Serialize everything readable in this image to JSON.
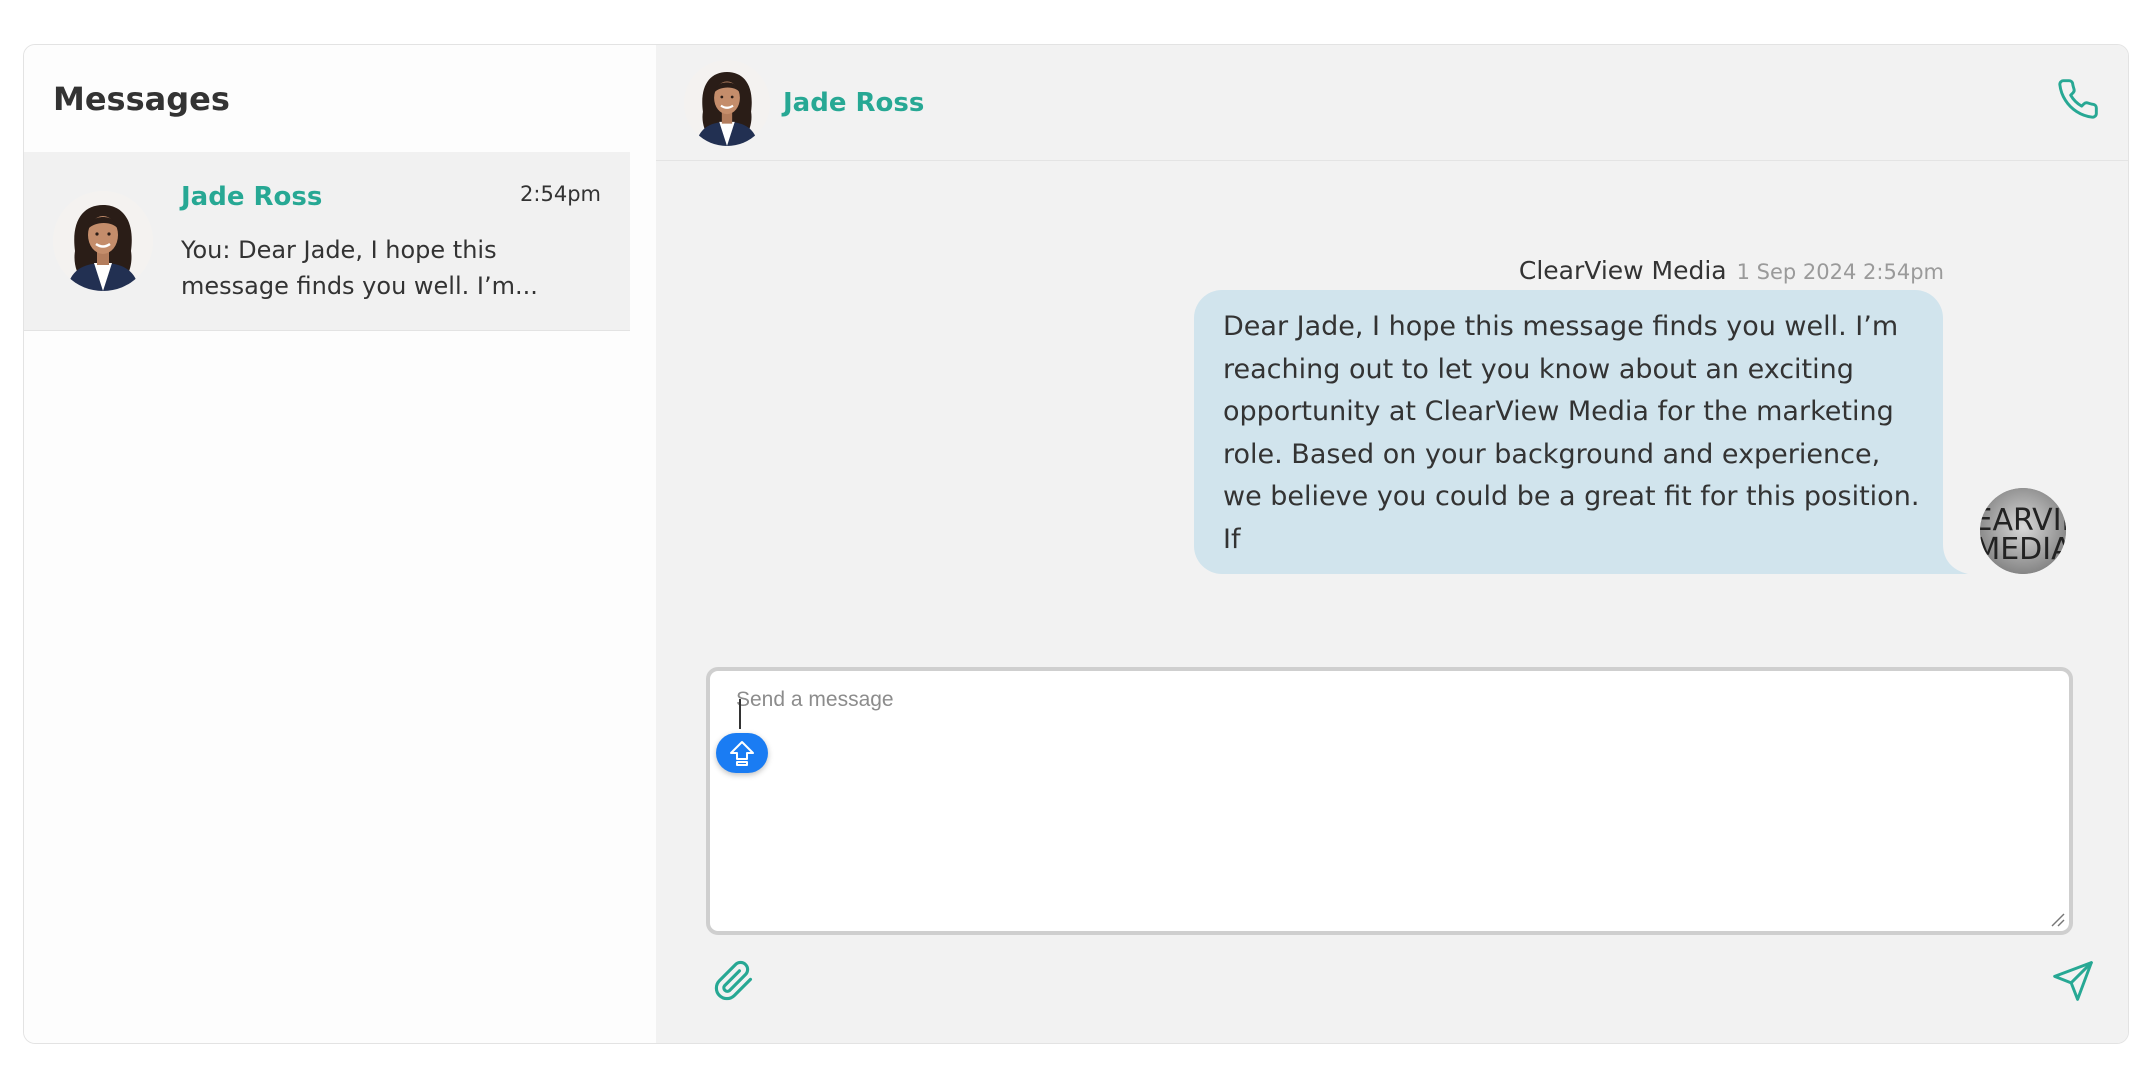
{
  "sidebar": {
    "title": "Messages",
    "conversations": [
      {
        "name": "Jade Ross",
        "time": "2:54pm",
        "preview": "You: Dear Jade, I hope this message finds you well. I’m..."
      }
    ]
  },
  "chat": {
    "contact_name": "Jade Ross",
    "messages": [
      {
        "sender": "ClearView Media",
        "timestamp": "1 Sep 2024 2:54pm",
        "text": "Dear Jade, I hope this message finds you well. I’m reaching out to let you know about an exciting opportunity at ClearView Media for the marketing role. Based on your background and experience, we believe you could be a great fit for this position. If",
        "avatar_text": "CLEARVIEW MEDIA"
      }
    ],
    "composer": {
      "placeholder": "Send a message",
      "value": ""
    }
  },
  "icons": {
    "call": "phone-icon",
    "attach": "paperclip-icon",
    "send": "send-icon",
    "assist": "shift-up-arrow-icon"
  },
  "colors": {
    "accent": "#27a894",
    "bubble": "#d1e4ed",
    "chat_background": "#f2f2f2",
    "selected_item": "#f1f1f1",
    "assist_badge": "#1a7cf3"
  }
}
